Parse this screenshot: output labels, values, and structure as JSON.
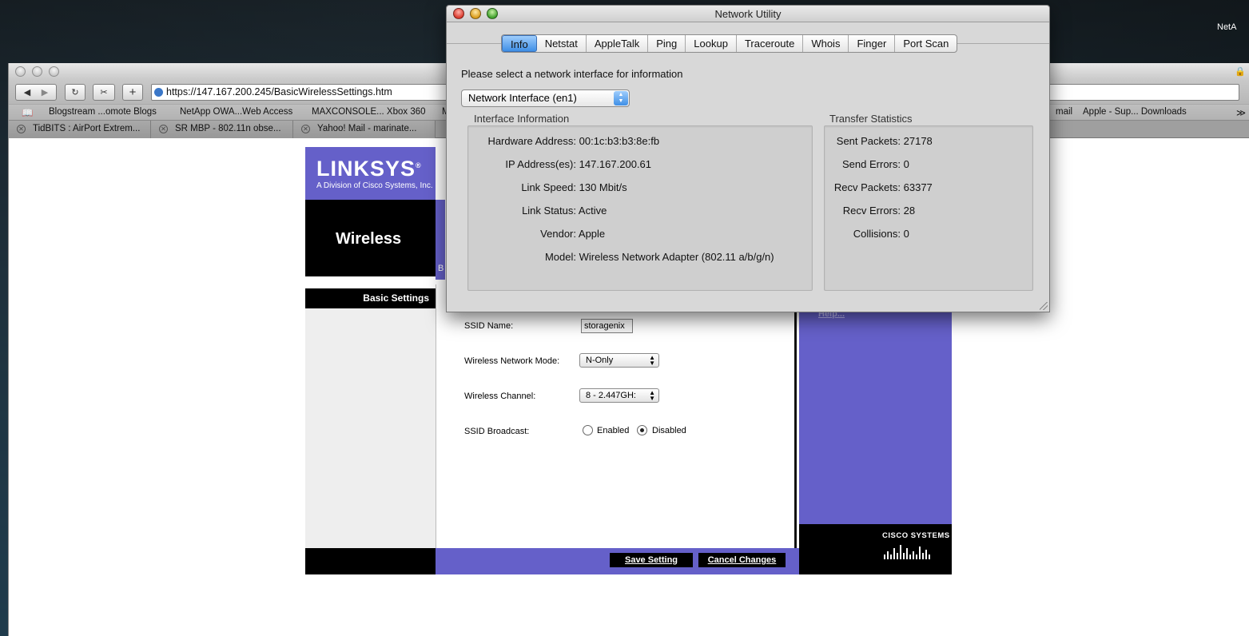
{
  "desktop": {
    "corner_text": "NetA"
  },
  "browser": {
    "url": "https://147.167.200.245/BasicWirelessSettings.htm",
    "bookmarks": [
      "Blogstream ...omote Blogs",
      "NetApp OWA...Web Access",
      "MAXCONSOLE... Xbox 360",
      "M",
      "mail",
      "Apple - Sup... Downloads"
    ],
    "tabs": [
      "TidBITS : AirPort Extrem...",
      "SR MBP - 802.11n obse...",
      "Yahoo! Mail - marinate..."
    ]
  },
  "linksys": {
    "logo": "LINKSYS",
    "logo_reg": "®",
    "subtitle": "A Division of Cisco Systems, Inc.",
    "section": "Wireless",
    "basic_settings": "Basic Settings",
    "tab_fragment": "B",
    "help": "Help...",
    "fields": {
      "ssid_label": "SSID Name:",
      "ssid_value": "storagenix",
      "mode_label": "Wireless Network Mode:",
      "mode_value": "N-Only",
      "channel_label": "Wireless Channel:",
      "channel_value": "8 - 2.447GH:",
      "broadcast_label": "SSID Broadcast:",
      "enabled": "Enabled",
      "disabled": "Disabled"
    },
    "buttons": {
      "save": "Save Setting",
      "cancel": "Cancel Changes"
    },
    "cisco": "CISCO SYSTEMS"
  },
  "netutil": {
    "title": "Network Utility",
    "tabs": [
      "Info",
      "Netstat",
      "AppleTalk",
      "Ping",
      "Lookup",
      "Traceroute",
      "Whois",
      "Finger",
      "Port Scan"
    ],
    "active_tab": "Info",
    "prompt": "Please select a network interface for information",
    "interface": "Network Interface (en1)",
    "interface_info_title": "Interface Information",
    "interface_info": [
      {
        "label": "Hardware Address:",
        "value": "00:1c:b3:b3:8e:fb"
      },
      {
        "label": "IP Address(es):",
        "value": "147.167.200.61"
      },
      {
        "label": "Link Speed:",
        "value": "130 Mbit/s"
      },
      {
        "label": "Link Status:",
        "value": "Active"
      },
      {
        "label": "Vendor:",
        "value": "Apple"
      },
      {
        "label": "Model:",
        "value": "Wireless Network Adapter (802.11 a/b/g/n)"
      }
    ],
    "transfer_title": "Transfer Statistics",
    "transfer": [
      {
        "label": "Sent Packets:",
        "value": "27178"
      },
      {
        "label": "Send Errors:",
        "value": "0"
      },
      {
        "label": "Recv Packets:",
        "value": "63377"
      },
      {
        "label": "Recv Errors:",
        "value": "28"
      },
      {
        "label": "Collisions:",
        "value": "0"
      }
    ]
  }
}
